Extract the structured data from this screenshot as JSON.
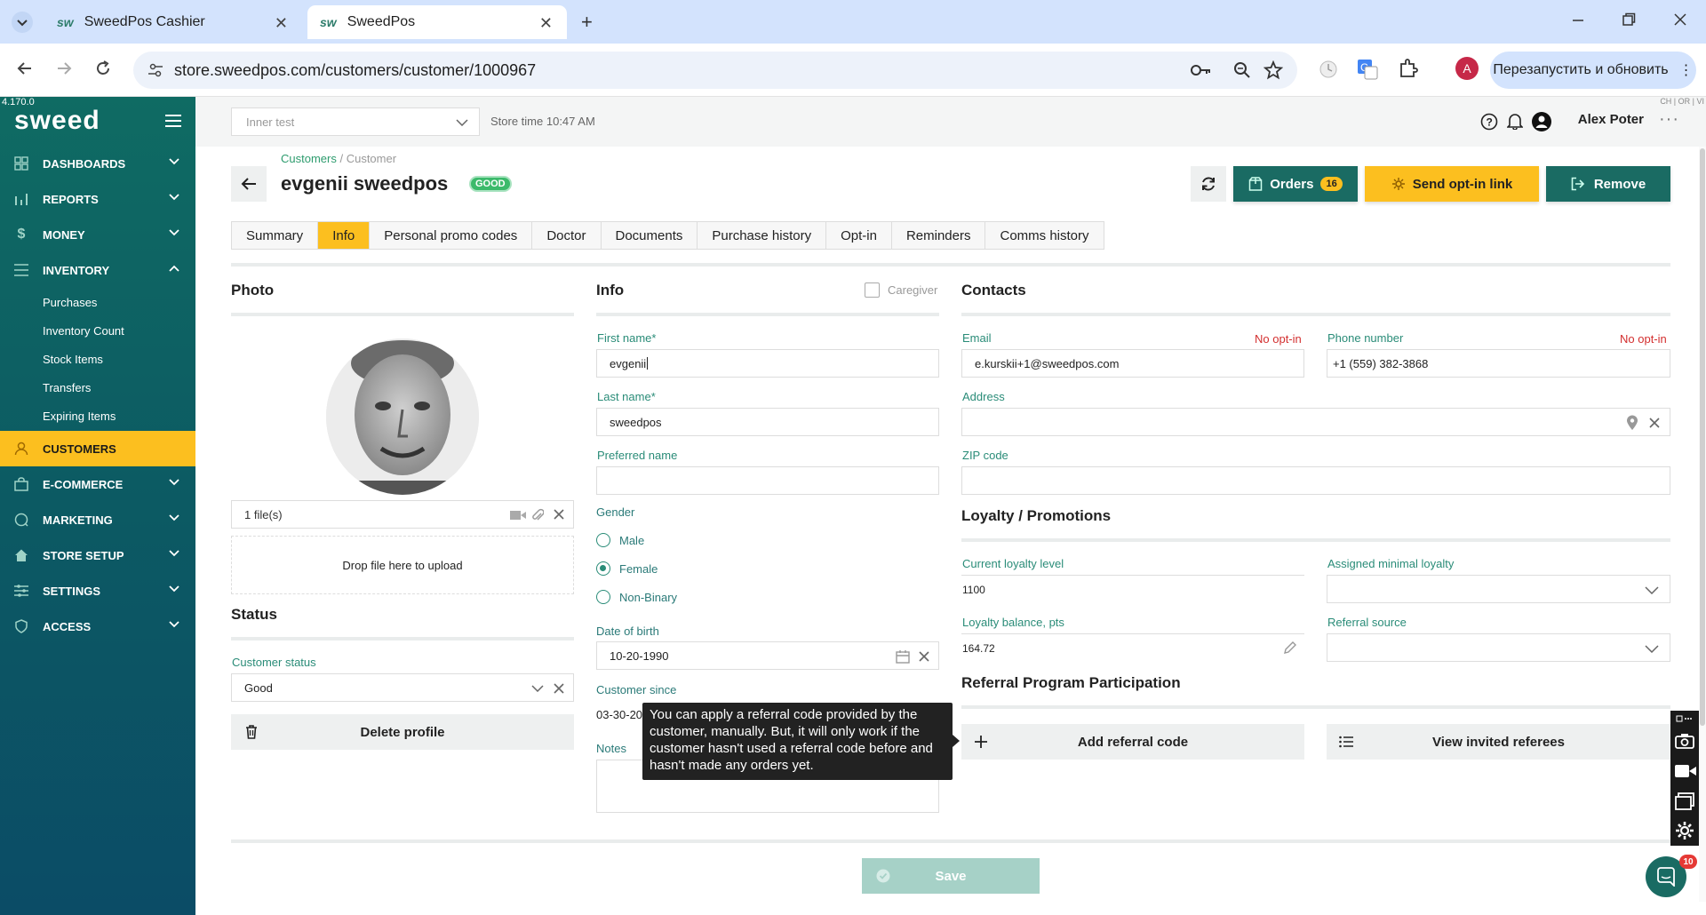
{
  "browser": {
    "tabs": [
      {
        "label": "SweedPos Cashier",
        "favicon": "sw"
      },
      {
        "label": "SweedPos",
        "favicon": "sw"
      }
    ],
    "url": "store.sweedpos.com/customers/customer/1000967",
    "relaunch_label": "Перезапустить и обновить",
    "profile_initial": "A"
  },
  "app": {
    "version": "4.170.0",
    "logo": "sweed",
    "store_placeholder": "Inner test",
    "store_time": "Store time 10:47 AM",
    "user_name": "Alex Poter",
    "corner_text": "CH | OR | VI"
  },
  "sidebar": {
    "items": [
      {
        "label": "DASHBOARDS",
        "icon": "grid-icon"
      },
      {
        "label": "REPORTS",
        "icon": "bar-chart-icon"
      },
      {
        "label": "MONEY",
        "icon": "dollar-icon"
      },
      {
        "label": "INVENTORY",
        "icon": "list-icon"
      },
      {
        "label": "CUSTOMERS",
        "icon": "user-icon"
      },
      {
        "label": "E-COMMERCE",
        "icon": "bag-icon"
      },
      {
        "label": "MARKETING",
        "icon": "chat-icon"
      },
      {
        "label": "STORE SETUP",
        "icon": "home-icon"
      },
      {
        "label": "SETTINGS",
        "icon": "sliders-icon"
      },
      {
        "label": "ACCESS",
        "icon": "shield-icon"
      }
    ],
    "inventory_sub": [
      "Purchases",
      "Inventory Count",
      "Stock Items",
      "Transfers",
      "Expiring Items"
    ]
  },
  "page": {
    "breadcrumb_root": "Customers",
    "breadcrumb_sep": " / ",
    "breadcrumb_current": "Customer",
    "title": "evgenii sweedpos",
    "badge": "GOOD",
    "orders_label": "Orders",
    "orders_count": "16",
    "optin_label": "Send opt-in link",
    "remove_label": "Remove",
    "tabs": [
      "Summary",
      "Info",
      "Personal promo codes",
      "Doctor",
      "Documents",
      "Purchase history",
      "Opt-in",
      "Reminders",
      "Comms history"
    ],
    "active_tab": "Info"
  },
  "photo": {
    "heading": "Photo",
    "files": "1 file(s)",
    "drop_text": "Drop file here to upload"
  },
  "status": {
    "heading": "Status",
    "label": "Customer status",
    "value": "Good",
    "delete_label": "Delete profile"
  },
  "info": {
    "heading": "Info",
    "caregiver": "Caregiver",
    "first_name_label": "First name*",
    "first_name": "evgenii",
    "last_name_label": "Last name*",
    "last_name": "sweedpos",
    "preferred_label": "Preferred name",
    "preferred": "",
    "gender_label": "Gender",
    "gender_options": [
      "Male",
      "Female",
      "Non-Binary"
    ],
    "gender_selected": "Female",
    "dob_label": "Date of birth",
    "dob": "10-20-1990",
    "since_label": "Customer since",
    "since": "03-30-20",
    "notes_label": "Notes"
  },
  "contacts": {
    "heading": "Contacts",
    "email_label": "Email",
    "email": "e.kurskii+1@sweedpos.com",
    "email_optin": "No opt-in",
    "phone_label": "Phone number",
    "phone": "+1 (559) 382-3868",
    "phone_optin": "No opt-in",
    "address_label": "Address",
    "zip_label": "ZIP code"
  },
  "loyalty": {
    "heading": "Loyalty / Promotions",
    "level_label": "Current loyalty level",
    "level": "1100",
    "assigned_label": "Assigned minimal loyalty",
    "balance_label": "Loyalty balance, pts",
    "balance": "164.72",
    "referral_source_label": "Referral source"
  },
  "referral": {
    "heading": "Referral Program Participation",
    "add_label": "Add referral code",
    "view_label": "View invited referees"
  },
  "tooltip": "You can apply a referral code provided by the customer, manually. But, it will only work if the customer hasn't used a referral code before and hasn't made any orders yet.",
  "save_label": "Save",
  "chat_badge": "10",
  "colors": {
    "accent": "#fcbf1f",
    "primary": "#1a6b63",
    "sidebar": "#0f6b63",
    "label": "#2a8c78",
    "danger": "#d32f2f"
  }
}
